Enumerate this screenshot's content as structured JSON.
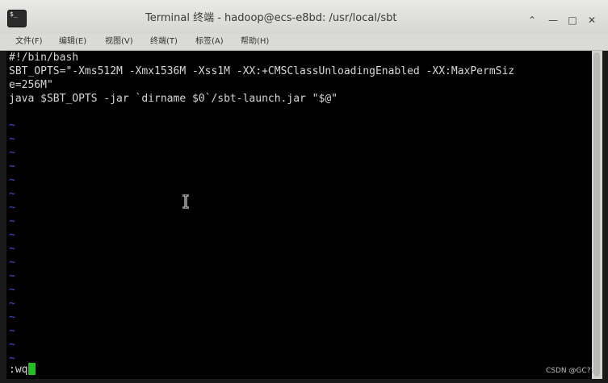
{
  "window": {
    "title": "Terminal 终端 - hadoop@ecs-e8bd: /usr/local/sbt",
    "app_icon_glyph": "$_",
    "buttons": {
      "up": "⌃",
      "minimize": "—",
      "maximize": "□",
      "close": "✕"
    }
  },
  "menubar": {
    "items": [
      "文件(F)",
      "编辑(E)",
      "视图(V)",
      "终端(T)",
      "标签(A)",
      "帮助(H)"
    ]
  },
  "terminal": {
    "lines": [
      "#!/bin/bash",
      "SBT_OPTS=\"-Xms512M -Xmx1536M -Xss1M -XX:+CMSClassUnloadingEnabled -XX:MaxPermSiz",
      "e=256M\"",
      "java $SBT_OPTS -jar `dirname $0`/sbt-launch.jar \"$@\""
    ],
    "empty_line_marker": "~",
    "command_line": ":wq"
  },
  "watermark": "CSDN @GC??",
  "colors": {
    "terminal_bg": "#000000",
    "text": "#d8d8d8",
    "tilde": "#3f51d8",
    "cursor": "#21c021"
  }
}
